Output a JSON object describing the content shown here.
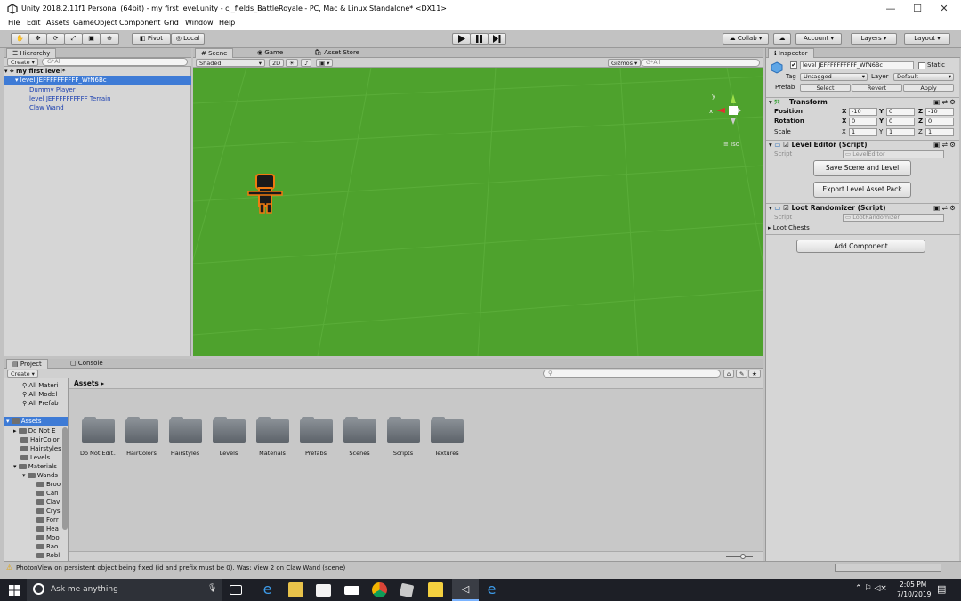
{
  "window": {
    "title": "Unity 2018.2.11f1 Personal (64bit) - my first level.unity - cj_fields_BattleRoyale - PC, Mac & Linux Standalone* <DX11>",
    "minimize": "—",
    "maximize": "☐",
    "close": "✕"
  },
  "menu": [
    "File",
    "Edit",
    "Assets",
    "GameObject",
    "Component",
    "Grid",
    "Window",
    "Help"
  ],
  "toolbar": {
    "pivot": "Pivot",
    "local": "Local",
    "collab": "Collab",
    "account": "Account",
    "layers": "Layers",
    "layout": "Layout"
  },
  "hierarchy": {
    "tab": "Hierarchy",
    "create": "Create",
    "search_placeholder": "G*All",
    "scene_name": "my first level*",
    "items": [
      "level JEFFFFFFFFFF_WfN6Bc",
      "Dummy Player",
      "level JEFFFFFFFFFF Terrain",
      "Claw Wand"
    ]
  },
  "scene": {
    "tabs": [
      "Scene",
      "Game",
      "Asset Store"
    ],
    "shading": "Shaded",
    "mode2d": "2D",
    "gizmos": "Gizmos",
    "search_placeholder": "G*All",
    "gizmo_label": "Iso",
    "axis_y": "y",
    "axis_x": "x"
  },
  "inspector": {
    "tab": "Inspector",
    "object_name": "level JEFFFFFFFFFF_WfN6Bc",
    "static": "Static",
    "tag_label": "Tag",
    "tag_value": "Untagged",
    "layer_label": "Layer",
    "layer_value": "Default",
    "prefab_label": "Prefab",
    "prefab_select": "Select",
    "prefab_revert": "Revert",
    "prefab_apply": "Apply",
    "transform": {
      "title": "Transform",
      "position": "Position",
      "rotation": "Rotation",
      "scale": "Scale",
      "pos": [
        "-10",
        "0",
        "-10"
      ],
      "rot": [
        "0",
        "0",
        "0"
      ],
      "scl": [
        "1",
        "1",
        "1"
      ],
      "axes": [
        "X",
        "Y",
        "Z"
      ]
    },
    "level_editor": {
      "title": "Level Editor (Script)",
      "script_label": "Script",
      "script_value": "LevelEditor",
      "btn_save": "Save Scene and Level",
      "btn_export": "Export Level Asset Pack"
    },
    "loot": {
      "title": "Loot Randomizer (Script)",
      "script_label": "Script",
      "script_value": "LootRandomizer",
      "chests": "Loot Chests"
    },
    "add_component": "Add Component"
  },
  "project": {
    "tabs": [
      "Project",
      "Console"
    ],
    "create": "Create",
    "favorites": [
      "All Materi",
      "All Model",
      "All Prefab"
    ],
    "tree_root": "Assets",
    "tree": [
      "Do Not E",
      "HairColor",
      "Hairstyles",
      "Levels",
      "Materials",
      "Wands",
      "Broo",
      "Can",
      "Clav",
      "Crys",
      "Forr",
      "Hea",
      "Moo",
      "Rao",
      "Robl"
    ],
    "breadcrumb": "Assets",
    "folders": [
      "Do Not Edit..",
      "HairColors",
      "Hairstyles",
      "Levels",
      "Materials",
      "Prefabs",
      "Scenes",
      "Scripts",
      "Textures"
    ]
  },
  "status": {
    "message": "PhotonView on persistent object being fixed (id and prefix must be 0). Was: View 2 on Claw Wand (scene)"
  },
  "taskbar": {
    "search": "Ask me anything",
    "time": "2:05 PM",
    "date": "7/10/2019"
  },
  "colors": {
    "scene_green": "#4ea22d",
    "selection": "#3e7bd6",
    "taskbar": "#1d1f26"
  }
}
